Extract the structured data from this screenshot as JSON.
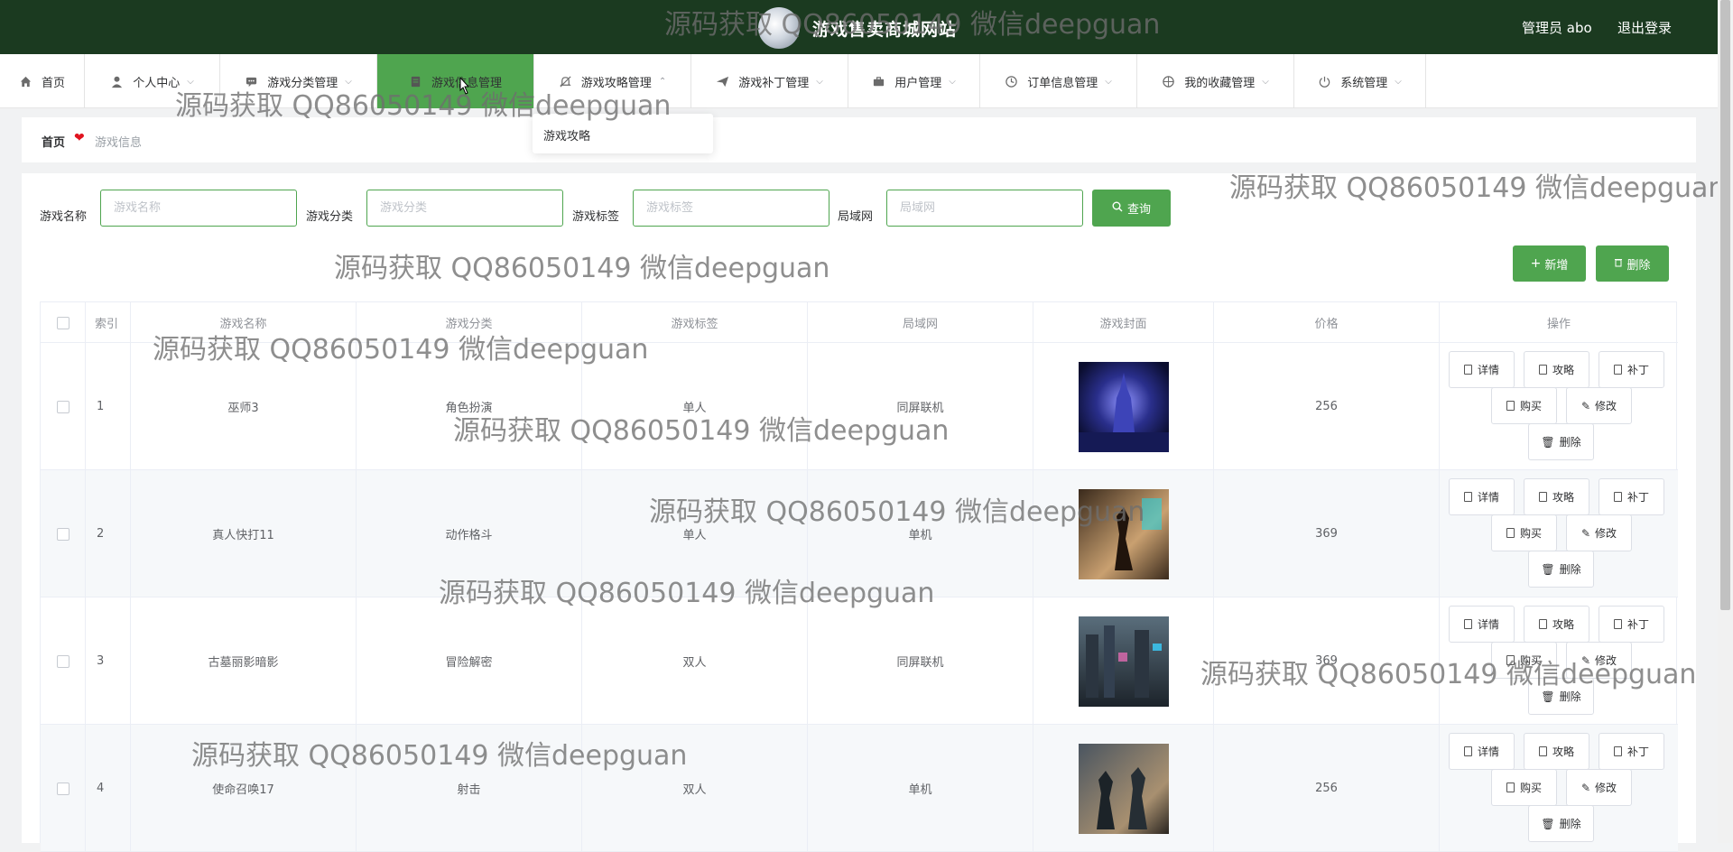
{
  "header": {
    "title": "游戏售卖商城网站",
    "admin": "管理员 abo",
    "logout": "退出登录"
  },
  "nav": [
    {
      "label": "首页",
      "icon": "home-icon",
      "caret": ""
    },
    {
      "label": "个人中心",
      "icon": "user-icon",
      "caret": "⌵"
    },
    {
      "label": "游戏分类管理",
      "icon": "chat-icon",
      "caret": "⌵"
    },
    {
      "label": "游戏信息管理",
      "icon": "doc-icon",
      "caret": ""
    },
    {
      "label": "游戏攻略管理",
      "icon": "bell-off-icon",
      "caret": "⌃"
    },
    {
      "label": "游戏补丁管理",
      "icon": "send-icon",
      "caret": "⌵"
    },
    {
      "label": "用户管理",
      "icon": "briefcase-icon",
      "caret": "⌵"
    },
    {
      "label": "订单信息管理",
      "icon": "clock-icon",
      "caret": "⌵"
    },
    {
      "label": "我的收藏管理",
      "icon": "compass-icon",
      "caret": "⌵"
    },
    {
      "label": "系统管理",
      "icon": "power-icon",
      "caret": "⌵"
    }
  ],
  "dropdown": {
    "item": "游戏攻略"
  },
  "breadcrumb": {
    "home": "首页",
    "current": "游戏信息"
  },
  "search": {
    "name_label": "游戏名称",
    "name_placeholder": "游戏名称",
    "category_label": "游戏分类",
    "category_placeholder": "游戏分类",
    "tag_label": "游戏标签",
    "tag_placeholder": "游戏标签",
    "lan_label": "局域网",
    "lan_placeholder": "局域网",
    "query_button": "查询"
  },
  "actions": {
    "add": "新增",
    "delete": "删除"
  },
  "table": {
    "headers": [
      "索引",
      "游戏名称",
      "游戏分类",
      "游戏标签",
      "局域网",
      "游戏封面",
      "价格",
      "操作"
    ],
    "ops": {
      "detail": "详情",
      "guide": "攻略",
      "patch": "补丁",
      "buy": "购买",
      "edit": "修改",
      "delete": "删除"
    },
    "rows": [
      {
        "index": "1",
        "name": "巫师3",
        "category": "角色扮演",
        "tag": "单人",
        "lan": "同屏联机",
        "price": "256"
      },
      {
        "index": "2",
        "name": "真人快打11",
        "category": "动作格斗",
        "tag": "单人",
        "lan": "单机",
        "price": "369"
      },
      {
        "index": "3",
        "name": "古墓丽影暗影",
        "category": "冒险解密",
        "tag": "双人",
        "lan": "同屏联机",
        "price": "369"
      },
      {
        "index": "4",
        "name": "使命召唤17",
        "category": "射击",
        "tag": "双人",
        "lan": "单机",
        "price": "256"
      }
    ]
  },
  "watermark": "源码获取 QQ86050149 微信deepguan"
}
